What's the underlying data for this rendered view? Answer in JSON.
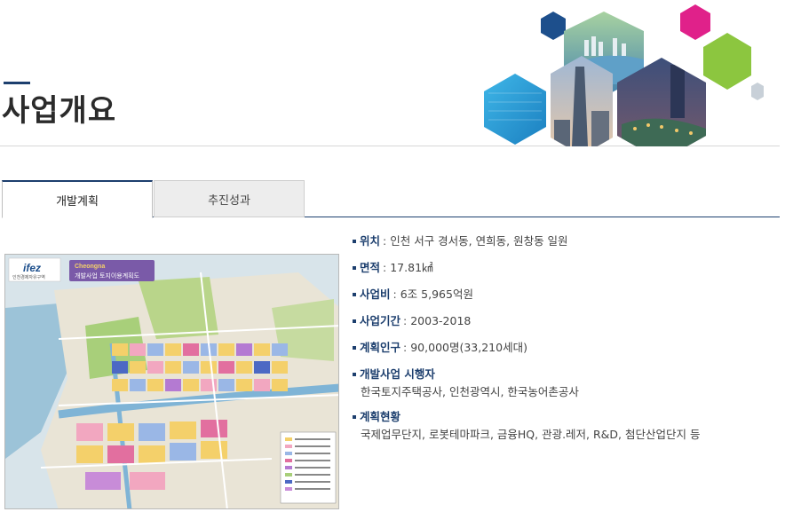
{
  "page": {
    "title": "사업개요"
  },
  "tabs": [
    {
      "label": "개발계획",
      "active": true
    },
    {
      "label": "추진성과",
      "active": false
    }
  ],
  "map": {
    "logo_text": "ifez",
    "logo_sub": "인천경제자유구역",
    "banner_title": "Cheongna",
    "banner_sub": "개발사업 토지이용계획도"
  },
  "overview": {
    "location": {
      "label": "위치",
      "value": "인천 서구 경서동, 연희동, 원창동 일원"
    },
    "area": {
      "label": "면적",
      "value": "17.81㎢"
    },
    "cost": {
      "label": "사업비",
      "value": "6조 5,965억원"
    },
    "period": {
      "label": "사업기간",
      "value": "2003-2018"
    },
    "population": {
      "label": "계획인구",
      "value": "90,000명(33,210세대)"
    },
    "developer": {
      "label": "개발사업 시행자",
      "value": "한국토지주택공사, 인천광역시, 한국농어촌공사"
    },
    "status": {
      "label": "계획현황",
      "value": "국제업무단지, 로봇테마파크, 금융HQ, 관광.레저, R&D, 첨단산업단지 등"
    }
  },
  "colors": {
    "accent": "#1d3f6e",
    "magenta": "#e0218a",
    "green": "#8cc63f",
    "cyan": "#1ba1d8",
    "navy": "#1d4f8c"
  }
}
